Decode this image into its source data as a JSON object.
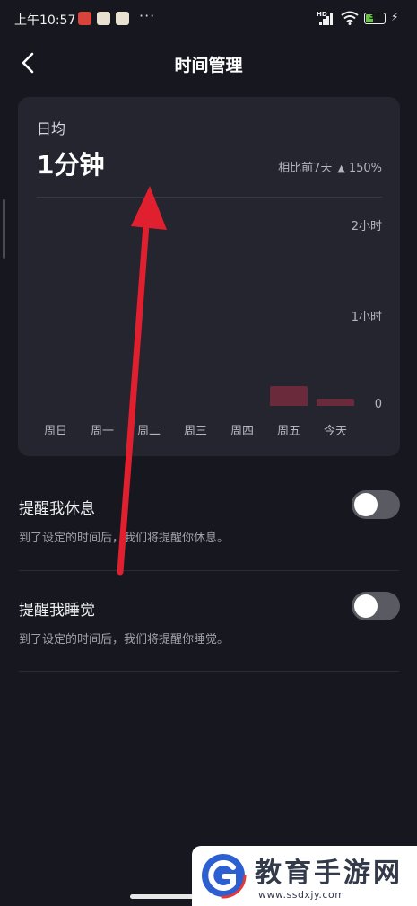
{
  "status_bar": {
    "time": "上午10:57",
    "dots": "···",
    "signal_label": "HD",
    "battery": "38"
  },
  "header": {
    "title": "时间管理"
  },
  "summary": {
    "label": "日均",
    "value": "1分钟",
    "compare_label": "相比前7天",
    "compare_value": "150%"
  },
  "chart_data": {
    "type": "bar",
    "categories": [
      "周日",
      "周一",
      "周二",
      "周三",
      "周四",
      "周五",
      "今天"
    ],
    "values": [
      0,
      0,
      0,
      0,
      0,
      13,
      5
    ],
    "value_unit": "minutes",
    "y_ticks": [
      "2小时",
      "1小时",
      "0"
    ],
    "ylim": [
      0,
      120
    ],
    "bar_color": "#6b2a3b",
    "grid": false
  },
  "settings": [
    {
      "title": "提醒我休息",
      "description": "到了设定的时间后，我们将提醒你休息。",
      "enabled": false
    },
    {
      "title": "提醒我睡觉",
      "description": "到了设定的时间后，我们将提醒你睡觉。",
      "enabled": false
    }
  ],
  "watermark": {
    "title": "教育手游网",
    "url": "www.ssdxjy.com"
  },
  "colors": {
    "background": "#17171f",
    "card": "#25252f",
    "annotation_arrow": "#e0202f"
  },
  "icons": {
    "back": "chevron-left-icon",
    "compare_arrow": "arrow-up-icon"
  }
}
